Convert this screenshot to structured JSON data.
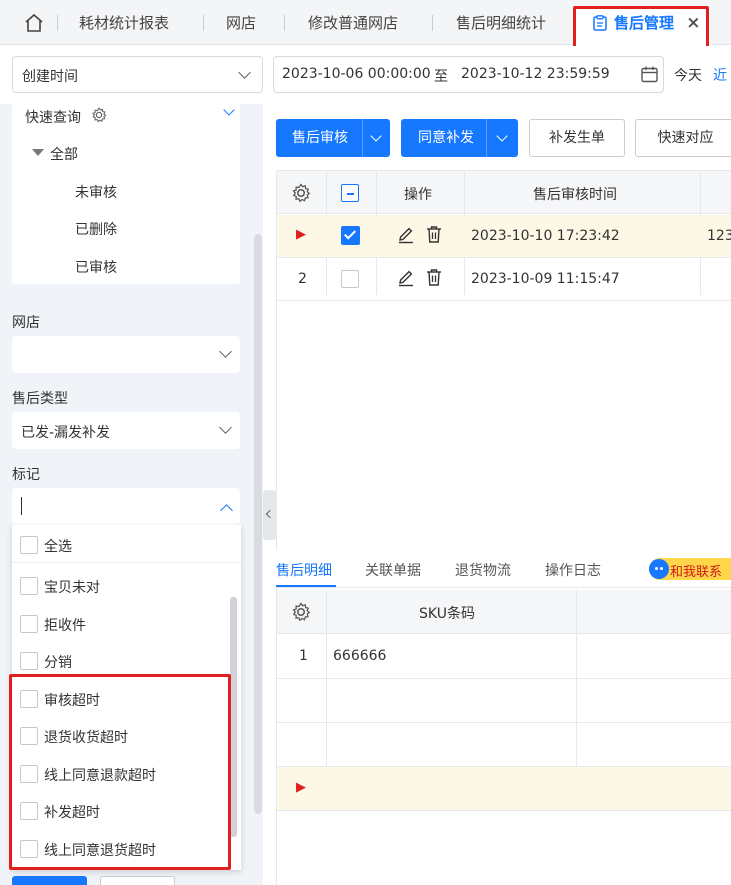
{
  "tabs": {
    "home_icon": "home-icon",
    "items": [
      "耗材统计报表",
      "网店",
      "修改普通网店",
      "售后明细统计"
    ],
    "active": "售后管理",
    "close": "×"
  },
  "filter": {
    "date_type": "创建时间",
    "start": "2023-10-06 00:00:00",
    "to": "至",
    "end": "2023-10-12 23:59:59",
    "today": "今天",
    "recent": "近"
  },
  "sidebar": {
    "quick_query": "快速查询",
    "tree_root": "全部",
    "tree_items": [
      "未审核",
      "已删除",
      "已审核"
    ],
    "shop_label": "网店",
    "shop_value": "",
    "type_label": "售后类型",
    "type_value": "已发-漏发补发",
    "mark_label": "标记",
    "mark_input": "",
    "mark_options": [
      "全选",
      "宝贝未对",
      "拒收件",
      "分销",
      "审核超时",
      "退货收货超时",
      "线上同意退款超时",
      "补发超时",
      "线上同意退货超时"
    ]
  },
  "toolbar": {
    "audit": "售后审核",
    "agree_resend": "同意补发",
    "resend_order": "补发生单",
    "quick_match": "快速对应"
  },
  "grid": {
    "col_action": "操作",
    "col_audit_time": "售后审核时间",
    "rows": [
      {
        "marker": "▶",
        "audit_time": "2023-10-10 17:23:42",
        "extra": "123",
        "checked": true
      },
      {
        "marker": "2",
        "audit_time": "2023-10-09 11:15:47",
        "extra": "",
        "checked": false
      }
    ]
  },
  "bottom_tabs": [
    "售后明细",
    "关联单据",
    "退货物流",
    "操作日志"
  ],
  "contact": "和我联系",
  "detail": {
    "col_sku": "SKU条码",
    "rows": [
      {
        "no": "1",
        "sku": "666666"
      },
      {
        "no": "",
        "sku": ""
      },
      {
        "no": "",
        "sku": ""
      },
      {
        "no": "▶",
        "sku": ""
      }
    ]
  },
  "colors": {
    "accent": "#1677ff",
    "highlight": "#e02020",
    "row_selected": "#fdf8e6"
  }
}
